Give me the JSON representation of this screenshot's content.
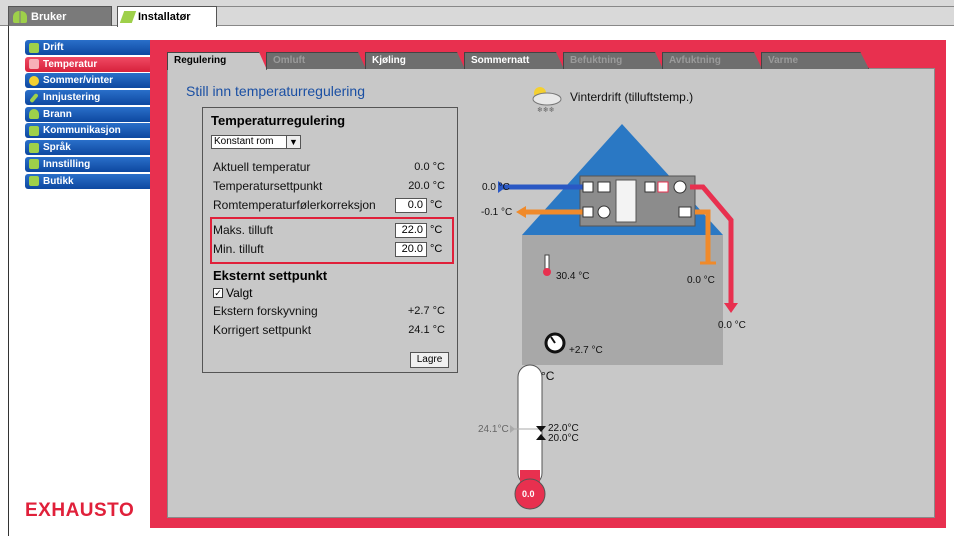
{
  "top_tabs": [
    {
      "label": "Bruker"
    },
    {
      "label": "Installatør"
    }
  ],
  "sidebar": {
    "items": [
      {
        "label": "Drift",
        "color": "#2a6fc9"
      },
      {
        "label": "Temperatur",
        "color": "#e8304f"
      },
      {
        "label": "Sommer/vinter",
        "color": "#2a6fc9"
      },
      {
        "label": "Innjustering",
        "color": "#2a6fc9"
      },
      {
        "label": "Brann",
        "color": "#2a6fc9"
      },
      {
        "label": "Kommunikasjon",
        "color": "#2a6fc9"
      },
      {
        "label": "Språk",
        "color": "#2a6fc9"
      },
      {
        "label": "Innstilling",
        "color": "#2a6fc9"
      },
      {
        "label": "Butikk",
        "color": "#2a6fc9"
      }
    ]
  },
  "logo": "EXHAUSTO",
  "tabs": [
    {
      "label": "Regulering"
    },
    {
      "label": "Omluft"
    },
    {
      "label": "Kjøling"
    },
    {
      "label": "Sommernatt"
    },
    {
      "label": "Befuktning"
    },
    {
      "label": "Avfuktning"
    },
    {
      "label": "Varme"
    }
  ],
  "heading": "Still inn temperaturregulering",
  "reg": {
    "title": "Temperaturregulering",
    "mode_selected": "Konstant rom",
    "rows": {
      "actual_label": "Aktuell temperatur",
      "actual_value": "0.0 °C",
      "setpoint_label": "Temperatursettpunkt",
      "setpoint_value": "20.0 °C",
      "corr_label": "Romtemperaturfølerkorreksjon",
      "corr_value": "0.0",
      "max_label": "Maks. tilluft",
      "max_value": "22.0",
      "min_label": "Min. tilluft",
      "min_value": "20.0",
      "unit": "°C"
    },
    "ext_title": "Eksternt settpunkt",
    "ext_checkbox_label": "Valgt",
    "ext_offset_label": "Ekstern forskyvning",
    "ext_offset_value": "+2.7 °C",
    "corrected_label": "Korrigert settpunkt",
    "corrected_value": "24.1 °C",
    "save_label": "Lagre"
  },
  "diagram": {
    "mode_label": "Vinterdrift (tilluftstemp.)",
    "outdoor_in": "0.0 °C",
    "exhaust_out": "-0.1 °C",
    "room_temp": "30.4 °C",
    "extract_temp": "0.0 °C",
    "supply_temp": "0.0 °C",
    "offset": "+2.7 °C",
    "thermo_unit": "°C",
    "thermo_setpoint": "24.1°C",
    "thermo_max": "22.0°C",
    "thermo_min": "20.0°C",
    "thermo_bulb": "0.0"
  },
  "colors": {
    "accent_red": "#e8304f",
    "nav_blue": "#1a5bb8",
    "roof_blue": "#2a78c4",
    "house_grey": "#a8a8a8",
    "supply_red": "#e8304f",
    "extract_orange": "#f08a2a",
    "intake_blue": "#2a58c4"
  }
}
